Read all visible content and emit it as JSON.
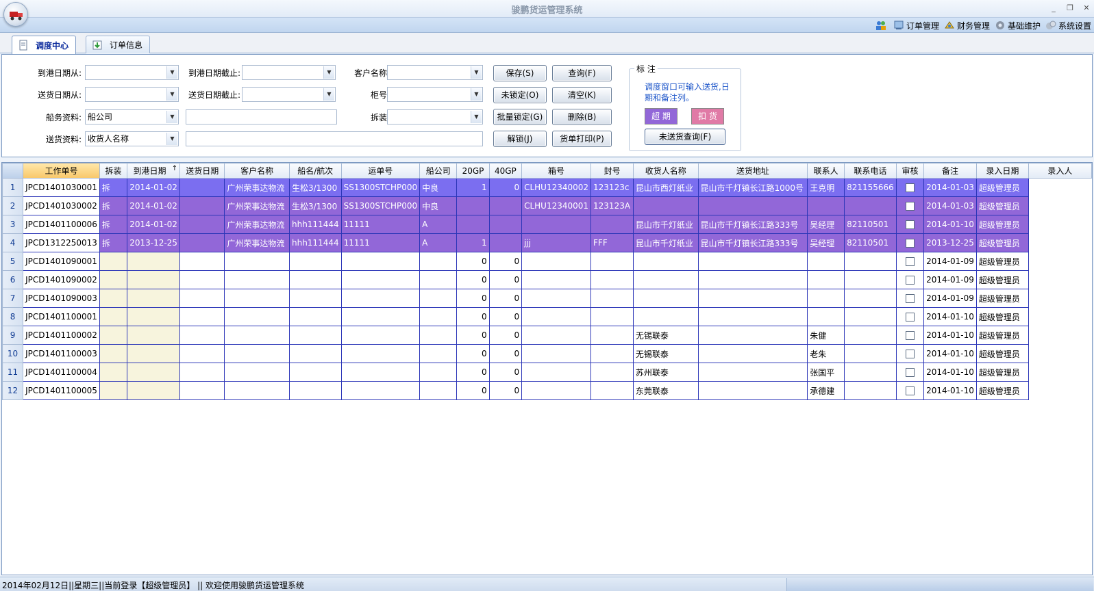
{
  "window": {
    "title": "骏鹏货运管理系统",
    "minimize": "_",
    "restore": "❐",
    "close": "✕"
  },
  "menu": [
    {
      "label": "订单管理",
      "icon": "order-icon"
    },
    {
      "label": "财务管理",
      "icon": "finance-icon"
    },
    {
      "label": "基础维护",
      "icon": "gear-icon"
    },
    {
      "label": "系统设置",
      "icon": "settings-icon"
    }
  ],
  "tabs": [
    {
      "label": "调度中心",
      "active": true
    },
    {
      "label": "订单信息",
      "active": false
    }
  ],
  "filter": {
    "arrive_from_label": "到港日期从:",
    "arrive_to_label": "到港日期截止:",
    "customer_label": "客户名称:",
    "deliver_from_label": "送货日期从:",
    "deliver_to_label": "送货日期截止:",
    "container_label": "柜号:",
    "shipping_label": "船务资料:",
    "shipping_value": "船公司",
    "unpack_label": "拆装:",
    "delivery_label": "送货资料:",
    "delivery_value": "收货人名称"
  },
  "buttons": {
    "save": "保存(S)",
    "query": "查询(F)",
    "unlocked": "未锁定(O)",
    "clear": "清空(K)",
    "batch_lock": "批量锁定(G)",
    "delete": "删除(B)",
    "unlock": "解锁(J)",
    "print": "货单打印(P)"
  },
  "legend": {
    "title": "标 注",
    "note": "调度窗口可输入送货,日期和备注列。",
    "overdue": "超 期",
    "overdue_color": "#9267d8",
    "deduct": "扣 货",
    "deduct_color": "#e07aa6",
    "undelivered_query": "未送货查询(F)"
  },
  "grid": {
    "columns": [
      "工作单号",
      "拆装",
      "到港日期",
      "送货日期",
      "客户名称",
      "船名/航次",
      "运单号",
      "船公司",
      "20GP",
      "40GP",
      "箱号",
      "封号",
      "收货人名称",
      "送货地址",
      "联系人",
      "联系电话",
      "审核",
      "备注",
      "录入日期",
      "录入人"
    ],
    "sort_indicator": "↑",
    "rows": [
      [
        "1",
        "JPCD1401030001",
        "拆",
        "2014-01-02",
        "",
        "广州荣事达物流",
        "生松3/1300",
        "SS1300STCHP000",
        "中良",
        "1",
        "0",
        "CLHU12340002",
        "123123c",
        "昆山市西灯纸业",
        "昆山市千灯镇长江路1000号",
        "王克明",
        "821155666",
        "",
        "2014-01-03",
        "超级管理员"
      ],
      [
        "2",
        "JPCD1401030002",
        "拆",
        "2014-01-02",
        "",
        "广州荣事达物流",
        "生松3/1300",
        "SS1300STCHP000",
        "中良",
        "",
        "",
        "CLHU12340001",
        "123123A",
        "",
        "",
        "",
        "",
        "",
        "2014-01-03",
        "超级管理员"
      ],
      [
        "3",
        "JPCD1401100006",
        "拆",
        "2014-01-02",
        "",
        "广州荣事达物流",
        "hhh111444",
        "11111",
        "A",
        "",
        "",
        "",
        "",
        "昆山市千灯纸业",
        "昆山市千灯镇长江路333号",
        "吴经理",
        "82110501",
        "",
        "2014-01-10",
        "超级管理员"
      ],
      [
        "4",
        "JPCD1312250013",
        "拆",
        "2013-12-25",
        "",
        "广州荣事达物流",
        "hhh111444",
        "11111",
        "A",
        "1",
        "",
        "jjj",
        "FFF",
        "昆山市千灯纸业",
        "昆山市千灯镇长江路333号",
        "吴经理",
        "82110501",
        "",
        "2013-12-25",
        "超级管理员"
      ],
      [
        "5",
        "JPCD1401090001",
        "",
        "",
        "",
        "",
        "",
        "",
        "",
        "0",
        "0",
        "",
        "",
        "",
        "",
        "",
        "",
        "",
        "2014-01-09",
        "超级管理员"
      ],
      [
        "6",
        "JPCD1401090002",
        "",
        "",
        "",
        "",
        "",
        "",
        "",
        "0",
        "0",
        "",
        "",
        "",
        "",
        "",
        "",
        "",
        "2014-01-09",
        "超级管理员"
      ],
      [
        "7",
        "JPCD1401090003",
        "",
        "",
        "",
        "",
        "",
        "",
        "",
        "0",
        "0",
        "",
        "",
        "",
        "",
        "",
        "",
        "",
        "2014-01-09",
        "超级管理员"
      ],
      [
        "8",
        "JPCD1401100001",
        "",
        "",
        "",
        "",
        "",
        "",
        "",
        "0",
        "0",
        "",
        "",
        "",
        "",
        "",
        "",
        "",
        "2014-01-10",
        "超级管理员"
      ],
      [
        "9",
        "JPCD1401100002",
        "",
        "",
        "",
        "",
        "",
        "",
        "",
        "0",
        "0",
        "",
        "",
        "无锡联泰",
        "",
        "朱健",
        "",
        "",
        "2014-01-10",
        "超级管理员"
      ],
      [
        "10",
        "JPCD1401100003",
        "",
        "",
        "",
        "",
        "",
        "",
        "",
        "0",
        "0",
        "",
        "",
        "无锡联泰",
        "",
        "老朱",
        "",
        "",
        "2014-01-10",
        "超级管理员"
      ],
      [
        "11",
        "JPCD1401100004",
        "",
        "",
        "",
        "",
        "",
        "",
        "",
        "0",
        "0",
        "",
        "",
        "苏州联泰",
        "",
        "张国平",
        "",
        "",
        "2014-01-10",
        "超级管理员"
      ],
      [
        "12",
        "JPCD1401100005",
        "",
        "",
        "",
        "",
        "",
        "",
        "",
        "0",
        "0",
        "",
        "",
        "东莞联泰",
        "",
        "承德建",
        "",
        "",
        "2014-01-10",
        "超级管理员"
      ]
    ]
  },
  "status": {
    "text": "2014年02月12日||星期三||当前登录【超级管理员】 || 欢迎使用骏鹏货运管理系统"
  }
}
